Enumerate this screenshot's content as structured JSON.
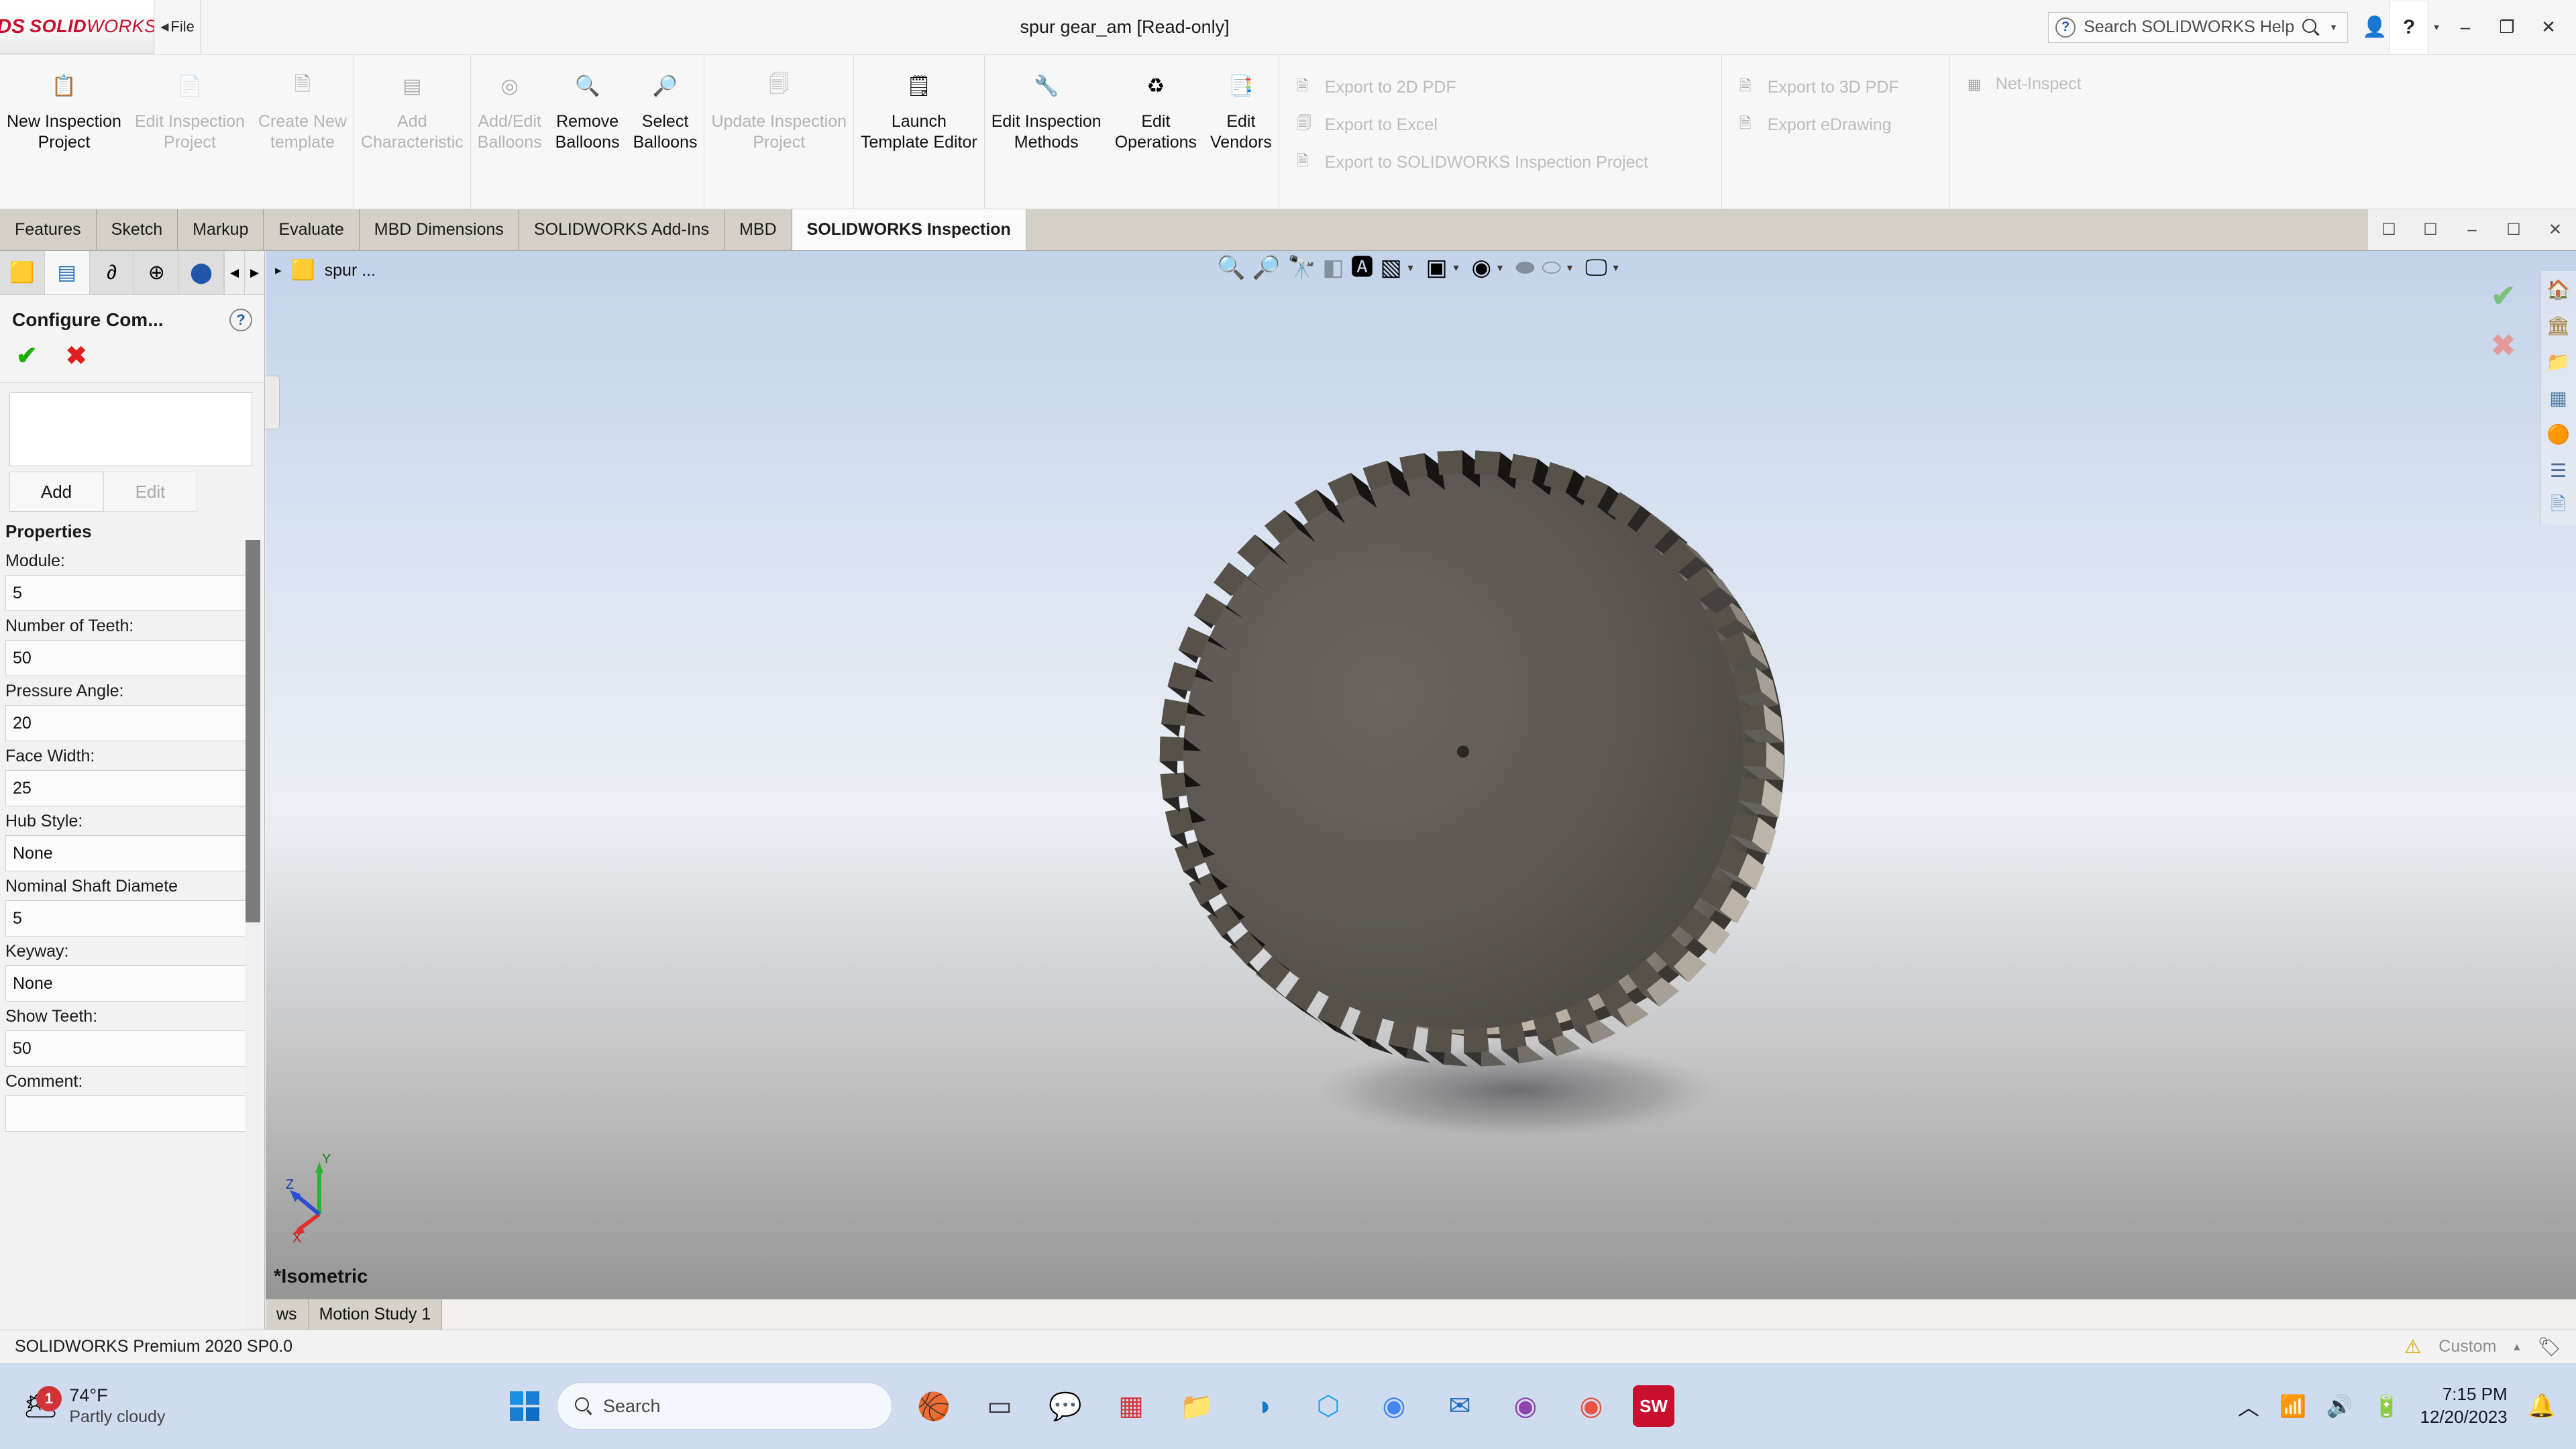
{
  "titlebar": {
    "logo_ds": "DS",
    "logo_solid": "SOLID",
    "logo_works": "WORKS",
    "file_menu": "File",
    "document_title": "spur gear_am [Read-only]",
    "help_search_placeholder": "Search SOLIDWORKS Help",
    "help_button": "?",
    "minimize": "–",
    "restore": "❐",
    "close": "✕"
  },
  "ribbon": {
    "groups": [
      {
        "name": "project",
        "buttons": [
          {
            "label_line1": "New Inspection",
            "label_line2": "Project",
            "icon": "new-inspection-project-icon",
            "glyph": "📋",
            "enabled": true
          },
          {
            "label_line1": "Edit Inspection",
            "label_line2": "Project",
            "icon": "edit-inspection-project-icon",
            "glyph": "📄",
            "enabled": false
          },
          {
            "label_line1": "Create New",
            "label_line2": "template",
            "icon": "create-new-template-icon",
            "glyph": "🗎",
            "enabled": false
          }
        ]
      },
      {
        "name": "characteristic",
        "buttons": [
          {
            "label_line1": "Add",
            "label_line2": "Characteristic",
            "icon": "add-characteristic-icon",
            "glyph": "▤",
            "enabled": false
          }
        ]
      },
      {
        "name": "balloons",
        "buttons": [
          {
            "label_line1": "Add/Edit",
            "label_line2": "Balloons",
            "icon": "add-edit-balloons-icon",
            "glyph": "◎",
            "enabled": false
          },
          {
            "label_line1": "Remove",
            "label_line2": "Balloons",
            "icon": "remove-balloons-icon",
            "glyph": "🔍",
            "enabled": true
          },
          {
            "label_line1": "Select",
            "label_line2": "Balloons",
            "icon": "select-balloons-icon",
            "glyph": "🔎",
            "enabled": true
          }
        ]
      },
      {
        "name": "update",
        "buttons": [
          {
            "label_line1": "Update Inspection",
            "label_line2": "Project",
            "icon": "update-inspection-project-icon",
            "glyph": "🗐",
            "enabled": false
          }
        ]
      },
      {
        "name": "template-editor",
        "buttons": [
          {
            "label_line1": "Launch",
            "label_line2": "Template Editor",
            "icon": "launch-template-editor-icon",
            "glyph": "🗒",
            "enabled": true
          }
        ]
      },
      {
        "name": "edit-tools",
        "buttons": [
          {
            "label_line1": "Edit Inspection",
            "label_line2": "Methods",
            "icon": "edit-inspection-methods-icon",
            "glyph": "🔧",
            "enabled": true
          },
          {
            "label_line1": "Edit",
            "label_line2": "Operations",
            "icon": "edit-operations-icon",
            "glyph": "♻",
            "enabled": true
          },
          {
            "label_line1": "Edit",
            "label_line2": "Vendors",
            "icon": "edit-vendors-icon",
            "glyph": "📑",
            "enabled": true
          }
        ]
      }
    ],
    "export_col1": [
      {
        "label": "Export to 2D PDF",
        "icon": "export-2d-pdf-icon",
        "glyph": "🗎",
        "enabled": false
      },
      {
        "label": "Export to Excel",
        "icon": "export-excel-icon",
        "glyph": "🗐",
        "enabled": false
      },
      {
        "label": "Export to SOLIDWORKS Inspection Project",
        "icon": "export-sw-inspection-icon",
        "glyph": "🗎",
        "enabled": false
      }
    ],
    "export_col2": [
      {
        "label": "Export to 3D PDF",
        "icon": "export-3d-pdf-icon",
        "glyph": "🗎",
        "enabled": false
      },
      {
        "label": "Export eDrawing",
        "icon": "export-edrawing-icon",
        "glyph": "🗎",
        "enabled": false
      }
    ],
    "export_col3": [
      {
        "label": "Net-Inspect",
        "icon": "net-inspect-icon",
        "glyph": "▦",
        "enabled": false
      }
    ]
  },
  "command_tabs": {
    "items": [
      {
        "label": "Features",
        "active": false
      },
      {
        "label": "Sketch",
        "active": false
      },
      {
        "label": "Markup",
        "active": false
      },
      {
        "label": "Evaluate",
        "active": false
      },
      {
        "label": "MBD Dimensions",
        "active": false
      },
      {
        "label": "SOLIDWORKS Add-Ins",
        "active": false
      },
      {
        "label": "MBD",
        "active": false
      },
      {
        "label": "SOLIDWORKS Inspection",
        "active": true
      }
    ],
    "window_buttons": [
      "❐",
      "❐",
      "–",
      "❐",
      "✕"
    ]
  },
  "left_panel": {
    "manager_tabs": [
      {
        "name": "feature-manager-tab",
        "glyph": "🟨",
        "active": false
      },
      {
        "name": "property-manager-tab",
        "glyph": "☰",
        "active": true
      },
      {
        "name": "configuration-manager-tab",
        "glyph": "⑂",
        "active": false
      },
      {
        "name": "dimxpert-manager-tab",
        "glyph": "⊕",
        "active": false
      },
      {
        "name": "display-manager-tab",
        "glyph": "🔵",
        "active": false
      }
    ],
    "title": "Configure Com...",
    "help_glyph": "?",
    "confirm_check": "✔",
    "confirm_cancel": "✖",
    "add_button": "Add",
    "edit_button": "Edit",
    "properties_header": "Properties",
    "properties": [
      {
        "label": "Module:",
        "value": "5"
      },
      {
        "label": "Number of Teeth:",
        "value": "50"
      },
      {
        "label": "Pressure Angle:",
        "value": "20"
      },
      {
        "label": "Face Width:",
        "value": "25"
      },
      {
        "label": "Hub Style:",
        "value": "None"
      },
      {
        "label": "Nominal Shaft Diamete",
        "value": "5"
      },
      {
        "label": "Keyway:",
        "value": "None"
      },
      {
        "label": "Show Teeth:",
        "value": "50"
      },
      {
        "label": "Comment:",
        "value": ""
      }
    ]
  },
  "viewport": {
    "tree_item": "spur ...",
    "tree_caret": "▸",
    "orientation_label": "*Isometric",
    "toolbar": [
      {
        "name": "zoom-to-fit-icon",
        "glyph": "🔍",
        "dim": false,
        "caret": false
      },
      {
        "name": "zoom-to-area-icon",
        "glyph": "🔎",
        "dim": false,
        "caret": false
      },
      {
        "name": "previous-view-icon",
        "glyph": "🔭",
        "dim": false,
        "caret": false
      },
      {
        "name": "section-view-icon",
        "glyph": "◧",
        "dim": true,
        "caret": false
      },
      {
        "name": "view-orientation-icon",
        "glyph": "🄰",
        "dim": false,
        "caret": false
      },
      {
        "name": "display-style-icon",
        "glyph": "▧",
        "dim": false,
        "caret": true
      },
      {
        "name": "hide-show-items-icon",
        "glyph": "▣",
        "dim": false,
        "caret": true
      },
      {
        "name": "edit-appearance-icon",
        "glyph": "◉",
        "dim": false,
        "caret": true
      },
      {
        "name": "apply-scene-icon",
        "glyph": "⬬",
        "dim": true,
        "caret": false
      },
      {
        "name": "view-settings-icon",
        "glyph": "⬭",
        "dim": true,
        "caret": true
      },
      {
        "name": "display-monitor-icon",
        "glyph": "🖵",
        "dim": false,
        "caret": true
      }
    ],
    "right_toolbar": [
      {
        "name": "home-icon",
        "glyph": "🏠"
      },
      {
        "name": "appearances-icon",
        "glyph": "🏛"
      },
      {
        "name": "scenes-icon",
        "glyph": "🖼"
      },
      {
        "name": "decals-icon",
        "glyph": "⬚"
      },
      {
        "name": "lights-cameras-icon",
        "glyph": "🔵"
      },
      {
        "name": "custom-properties-icon",
        "glyph": "☰"
      },
      {
        "name": "display-states-icon",
        "glyph": "🖼"
      }
    ],
    "confirm_ok": "✔",
    "confirm_cancel": "✖",
    "triad_axes": {
      "x": "X",
      "y": "Y",
      "z": "Z"
    },
    "bottom_tabs": [
      {
        "label": "ws",
        "name": "model-views-tab"
      },
      {
        "label": "Motion Study 1",
        "name": "motion-study-tab"
      }
    ]
  },
  "statusbar": {
    "product": "SOLIDWORKS Premium 2020 SP0.0",
    "units": "Custom",
    "caret": "▴",
    "perf_icon": "⚠",
    "tag_icon": "🏷"
  },
  "taskbar": {
    "weather_temp": "74°F",
    "weather_desc": "Partly cloudy",
    "weather_badge": "1",
    "search_placeholder": "Search",
    "apps": [
      {
        "name": "task-view-icon",
        "glyph": "▭",
        "color": "#3a3a3a"
      },
      {
        "name": "chat-icon",
        "glyph": "💬",
        "color": "#7b5cd6"
      },
      {
        "name": "widgets-icon",
        "glyph": "▦",
        "color": "#d13438"
      },
      {
        "name": "file-explorer-icon",
        "glyph": "📁",
        "color": "#f5c242"
      },
      {
        "name": "edge-icon",
        "glyph": "◑",
        "color": "#0e79c4"
      },
      {
        "name": "vscode-icon",
        "glyph": "⬡",
        "color": "#2b9fe6"
      },
      {
        "name": "chrome-icon",
        "glyph": "◉",
        "color": "#4285f4"
      },
      {
        "name": "mail-icon",
        "glyph": "✉",
        "color": "#1b6ec2"
      },
      {
        "name": "chrome-profile-icon",
        "glyph": "◉",
        "color": "#8e44ad"
      },
      {
        "name": "acrobat-icon",
        "glyph": "◉",
        "color": "#e8543f"
      },
      {
        "name": "solidworks-app-icon",
        "glyph": "SW",
        "color": "#c8102e"
      }
    ],
    "time": "7:15 PM",
    "date": "12/20/2023",
    "chevron_up": "⌃",
    "wifi": "◠",
    "volume": "🔊",
    "battery": "🔋",
    "bell": "🔔"
  }
}
